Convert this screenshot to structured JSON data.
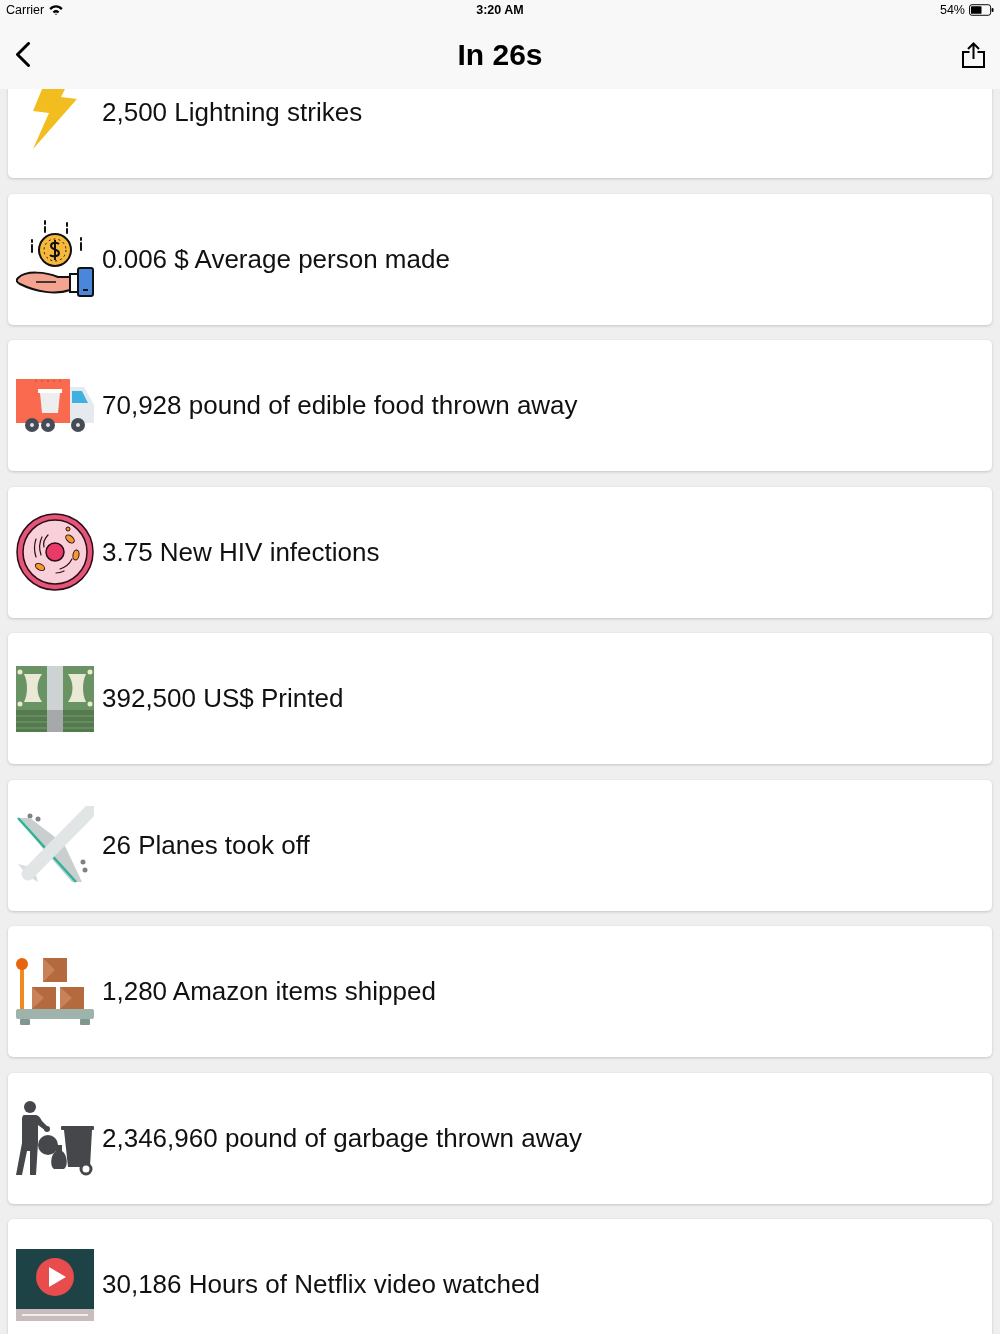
{
  "status_bar": {
    "carrier": "Carrier",
    "time": "3:20 AM",
    "battery": "54%"
  },
  "nav": {
    "title": "In 26s"
  },
  "stats": [
    {
      "text": "2,500 Lightning strikes"
    },
    {
      "text": "0.006 $ Average person made"
    },
    {
      "text": "70,928 pound of edible food thrown away"
    },
    {
      "text": "3.75 New HIV infections"
    },
    {
      "text": "392,500 US$ Printed"
    },
    {
      "text": "26 Planes took off"
    },
    {
      "text": "1,280 Amazon items shipped"
    },
    {
      "text": "2,346,960 pound of garbage thrown away"
    },
    {
      "text": "30,186 Hours of Netflix video watched"
    }
  ]
}
